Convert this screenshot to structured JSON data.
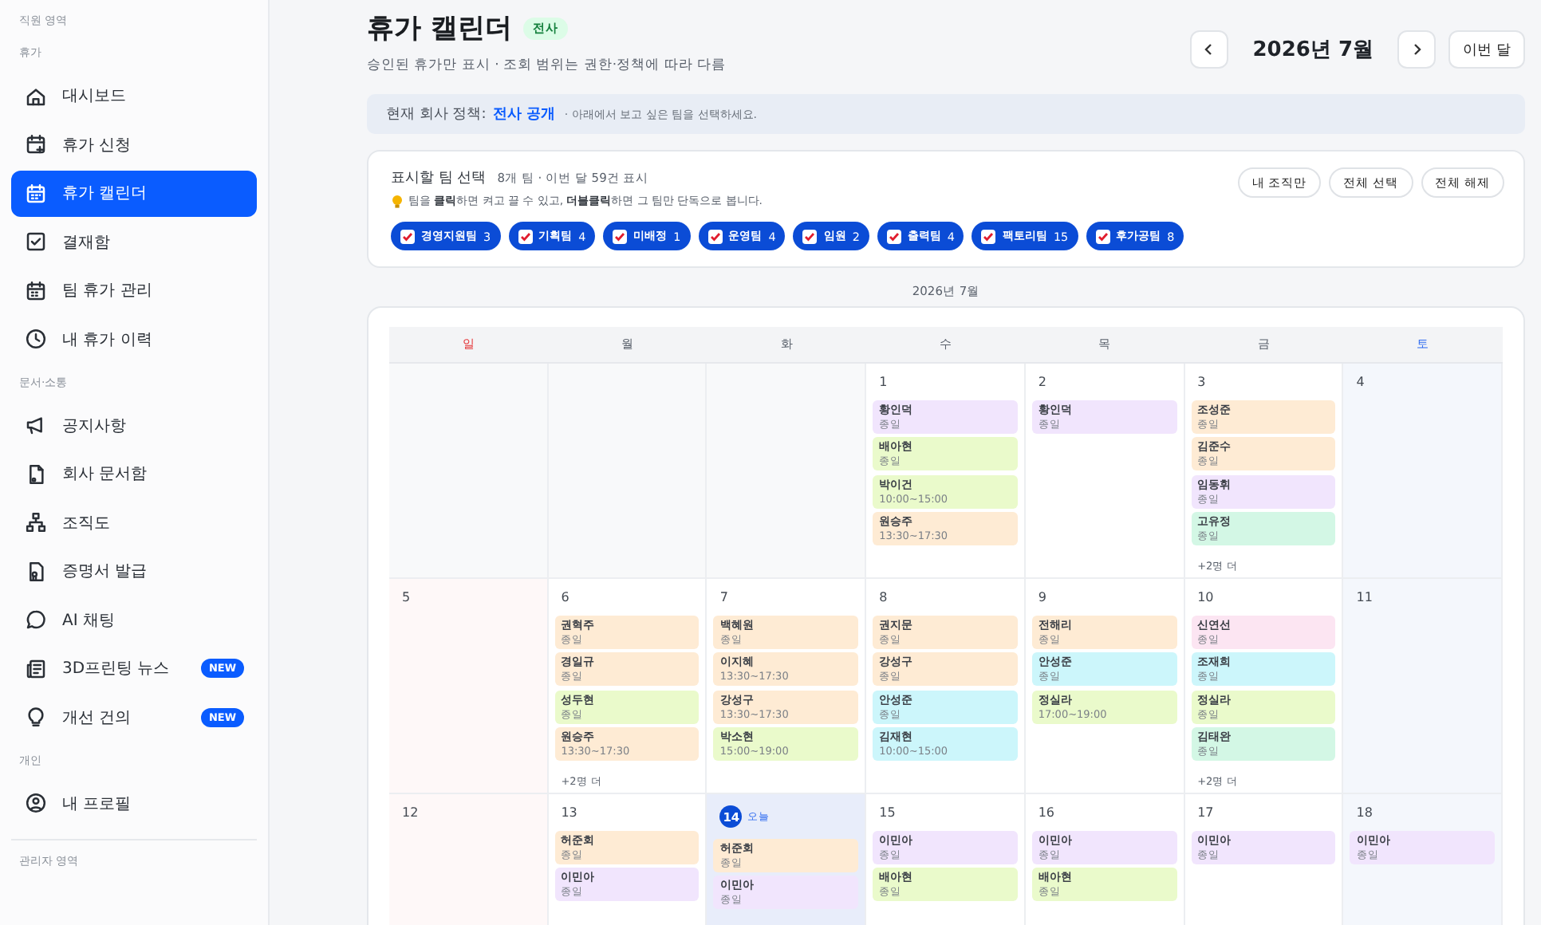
{
  "sidebar": {
    "area_label": "직원 영역",
    "groups": [
      {
        "heading": "휴가",
        "items": [
          {
            "label": "대시보드",
            "selected": false
          },
          {
            "label": "휴가 신청",
            "selected": false
          },
          {
            "label": "휴가 캘린더",
            "selected": true
          },
          {
            "label": "결재함",
            "selected": false
          },
          {
            "label": "팀 휴가 관리",
            "selected": false
          },
          {
            "label": "내 휴가 이력",
            "selected": false
          }
        ]
      },
      {
        "heading": "문서·소통",
        "items": [
          {
            "label": "공지사항",
            "selected": false
          },
          {
            "label": "회사 문서함",
            "selected": false
          },
          {
            "label": "조직도",
            "selected": false
          },
          {
            "label": "증명서 발급",
            "selected": false
          },
          {
            "label": "AI 채팅",
            "selected": false
          },
          {
            "label": "3D프린팅 뉴스",
            "selected": false,
            "badge": "NEW"
          },
          {
            "label": "개선 건의",
            "selected": false,
            "badge": "NEW"
          }
        ]
      },
      {
        "heading": "개인",
        "items": [
          {
            "label": "내 프로필",
            "selected": false
          }
        ]
      }
    ],
    "footer_label": "관리자 영역"
  },
  "header": {
    "title": "휴가 캘린더",
    "badge": "전사",
    "subtitle": "승인된 휴가만 표시 · 조회 범위는 권한·정책에 따라 다름",
    "month": "2026년 7월",
    "today_button": "이번 달"
  },
  "policy": {
    "label": "현재 회사 정책:",
    "value": "전사 공개",
    "hint": "· 아래에서 보고 싶은 팀을 선택하세요."
  },
  "team_panel": {
    "title": "표시할 팀 선택",
    "summary": "8개 팀 · 이번 달 59건 표시",
    "hint": "팀을 **클릭**하면 켜고 끌 수 있고, **더블클릭**하면 그 팀만 단독으로 봅니다.",
    "buttons": [
      "내 조직만",
      "전체 선택",
      "전체 해제"
    ],
    "teams": [
      {
        "label": "경영지원팀",
        "count": "3",
        "checked": true
      },
      {
        "label": "기획팀",
        "count": "4",
        "checked": true
      },
      {
        "label": "미배정",
        "count": "1",
        "checked": true
      },
      {
        "label": "운영팀",
        "count": "4",
        "checked": true
      },
      {
        "label": "임원",
        "count": "2",
        "checked": true
      },
      {
        "label": "출력팀",
        "count": "4",
        "checked": true
      },
      {
        "label": "팩토리팀",
        "count": "15",
        "checked": true
      },
      {
        "label": "후가공팀",
        "count": "8",
        "checked": true
      }
    ]
  },
  "calendar": {
    "caption": "2026년 7월",
    "weekdays": [
      {
        "label": "일",
        "kind": "sunday"
      },
      {
        "label": "월",
        "kind": "weekday"
      },
      {
        "label": "화",
        "kind": "weekday"
      },
      {
        "label": "수",
        "kind": "weekday"
      },
      {
        "label": "목",
        "kind": "weekday"
      },
      {
        "label": "금",
        "kind": "weekday"
      },
      {
        "label": "토",
        "kind": "saturday"
      }
    ],
    "weeks": [
      [
        {
          "kind": "blank"
        },
        {
          "kind": "blank"
        },
        {
          "kind": "blank"
        },
        {
          "kind": "weekday",
          "date": "1",
          "events": [
            {
              "name": "황인덕",
              "time": "종일",
              "color": "#f1e5fd"
            },
            {
              "name": "배아현",
              "time": "종일",
              "color": "#eafacb"
            },
            {
              "name": "박이건",
              "time": "10:00~15:00",
              "color": "#eafacb"
            },
            {
              "name": "원승주",
              "time": "13:30~17:30",
              "color": "#feebd4"
            }
          ]
        },
        {
          "kind": "weekday",
          "date": "2",
          "events": [
            {
              "name": "황인덕",
              "time": "종일",
              "color": "#f1e5fd"
            }
          ]
        },
        {
          "kind": "weekday",
          "date": "3",
          "events": [
            {
              "name": "조성준",
              "time": "종일",
              "color": "#feebd4"
            },
            {
              "name": "김준수",
              "time": "종일",
              "color": "#feebd4"
            },
            {
              "name": "임동휘",
              "time": "종일",
              "color": "#f1e5fd"
            },
            {
              "name": "고유정",
              "time": "종일",
              "color": "#d3f7e5"
            }
          ],
          "more": "+2명 더"
        },
        {
          "kind": "saturday",
          "date": "4"
        }
      ],
      [
        {
          "kind": "sunday",
          "date": "5"
        },
        {
          "kind": "weekday",
          "date": "6",
          "events": [
            {
              "name": "권혁주",
              "time": "종일",
              "color": "#feebd4"
            },
            {
              "name": "경일규",
              "time": "종일",
              "color": "#feebd4"
            },
            {
              "name": "성두현",
              "time": "종일",
              "color": "#eafacb"
            },
            {
              "name": "원승주",
              "time": "13:30~17:30",
              "color": "#feebd4"
            }
          ],
          "more": "+2명 더"
        },
        {
          "kind": "weekday",
          "date": "7",
          "events": [
            {
              "name": "백혜원",
              "time": "종일",
              "color": "#feebd4"
            },
            {
              "name": "이지혜",
              "time": "13:30~17:30",
              "color": "#feebd4"
            },
            {
              "name": "강성구",
              "time": "13:30~17:30",
              "color": "#feebd4"
            },
            {
              "name": "박소현",
              "time": "15:00~19:00",
              "color": "#eafacb"
            }
          ]
        },
        {
          "kind": "weekday",
          "date": "8",
          "events": [
            {
              "name": "권지문",
              "time": "종일",
              "color": "#feebd4"
            },
            {
              "name": "강성구",
              "time": "종일",
              "color": "#feebd4"
            },
            {
              "name": "안성준",
              "time": "종일",
              "color": "#ccf6fb"
            },
            {
              "name": "김재현",
              "time": "10:00~15:00",
              "color": "#ccf6fb"
            }
          ]
        },
        {
          "kind": "weekday",
          "date": "9",
          "events": [
            {
              "name": "전해리",
              "time": "종일",
              "color": "#feebd4"
            },
            {
              "name": "안성준",
              "time": "종일",
              "color": "#ccf6fb"
            },
            {
              "name": "정실라",
              "time": "17:00~19:00",
              "color": "#eafacb"
            }
          ]
        },
        {
          "kind": "weekday",
          "date": "10",
          "events": [
            {
              "name": "신연선",
              "time": "종일",
              "color": "#fce5f2"
            },
            {
              "name": "조재희",
              "time": "종일",
              "color": "#ccf6fb"
            },
            {
              "name": "정실라",
              "time": "종일",
              "color": "#eafacb"
            },
            {
              "name": "김태완",
              "time": "종일",
              "color": "#d3f7e5"
            }
          ],
          "more": "+2명 더"
        },
        {
          "kind": "saturday",
          "date": "11"
        }
      ],
      [
        {
          "kind": "sunday",
          "date": "12"
        },
        {
          "kind": "weekday",
          "date": "13",
          "events": [
            {
              "name": "허준회",
              "time": "종일",
              "color": "#feebd4"
            },
            {
              "name": "이민아",
              "time": "종일",
              "color": "#f1e5fd"
            }
          ]
        },
        {
          "kind": "weekday",
          "date": "14",
          "today": true,
          "today_label": "오늘",
          "events": [
            {
              "name": "허준회",
              "time": "종일",
              "color": "#feebd4"
            },
            {
              "name": "이민아",
              "time": "종일",
              "color": "#f1e5fd"
            }
          ]
        },
        {
          "kind": "weekday",
          "date": "15",
          "events": [
            {
              "name": "이민아",
              "time": "종일",
              "color": "#f1e5fd"
            },
            {
              "name": "배아현",
              "time": "종일",
              "color": "#eafacb"
            }
          ]
        },
        {
          "kind": "weekday",
          "date": "16",
          "events": [
            {
              "name": "이민아",
              "time": "종일",
              "color": "#f1e5fd"
            },
            {
              "name": "배아현",
              "time": "종일",
              "color": "#eafacb"
            }
          ]
        },
        {
          "kind": "weekday",
          "date": "17",
          "events": [
            {
              "name": "이민아",
              "time": "종일",
              "color": "#f1e5fd"
            }
          ]
        },
        {
          "kind": "saturday",
          "date": "18",
          "events": [
            {
              "name": "이민아",
              "time": "종일",
              "color": "#f1e5fd"
            }
          ]
        }
      ]
    ]
  }
}
